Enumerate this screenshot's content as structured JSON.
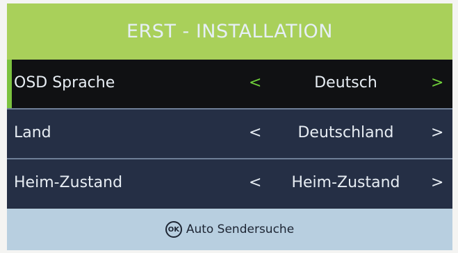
{
  "header": {
    "title": "ERST - INSTALLATION"
  },
  "rows": [
    {
      "label": "OSD Sprache",
      "value": "Deutsch"
    },
    {
      "label": "Land",
      "value": "Deutschland"
    },
    {
      "label": "Heim-Zustand",
      "value": "Heim-Zustand"
    }
  ],
  "arrows": {
    "left": "<",
    "right": ">"
  },
  "footer": {
    "ok_icon_text": "OK",
    "action_label": "Auto Sendersuche"
  },
  "colors": {
    "header_bg": "#a9d05a",
    "row_bg": "#252f45",
    "selected_row_bg": "#101113",
    "selected_accent": "#7cc23f",
    "footer_bg": "#b8cfe0"
  }
}
